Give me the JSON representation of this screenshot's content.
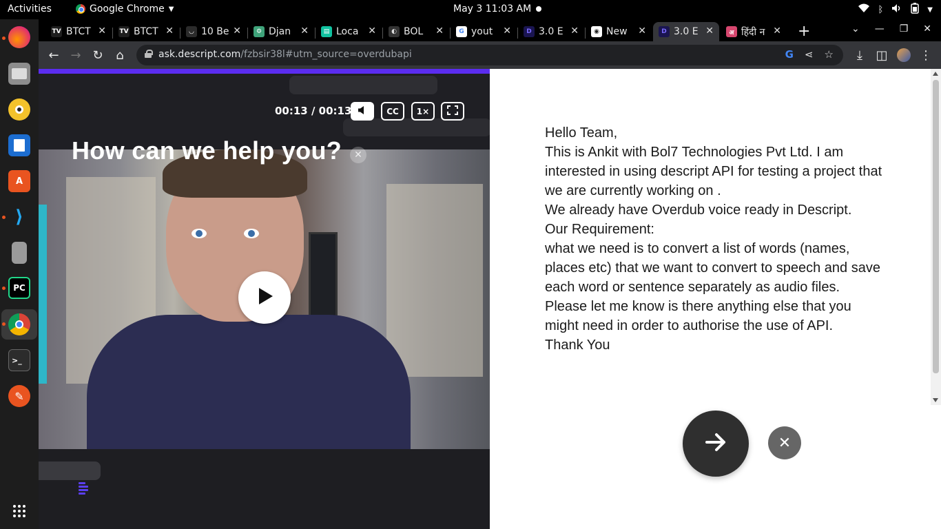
{
  "topbar": {
    "activities": "Activities",
    "app_name": "Google Chrome",
    "clock": "May 3  11:03 AM"
  },
  "dock": {
    "apps": [
      "firefox-icon",
      "files-icon",
      "rhythmbox-icon",
      "writer-icon",
      "software-icon",
      "vscode-icon",
      "archive-icon",
      "pycharm-icon",
      "chrome-icon",
      "terminal-icon",
      "pen-icon",
      "app-grid-icon"
    ]
  },
  "tabs": [
    {
      "title": "BTCT",
      "favicon": "TV"
    },
    {
      "title": "BTCT",
      "favicon": "TV"
    },
    {
      "title": "10 Be",
      "favicon": "◡"
    },
    {
      "title": "Djan",
      "favicon": "⚙"
    },
    {
      "title": "Loca",
      "favicon": "▤"
    },
    {
      "title": "BOL",
      "favicon": "◐"
    },
    {
      "title": "yout",
      "favicon": "G"
    },
    {
      "title": "3.0 E",
      "favicon": "D"
    },
    {
      "title": "New",
      "favicon": "◉"
    },
    {
      "title": "3.0 E",
      "favicon": "D",
      "active": true
    },
    {
      "title": "हिंदी न",
      "favicon": "अ"
    }
  ],
  "address_bar": {
    "host": "ask.descript.com",
    "path": "/fzbsir38l#utm_source=overdubapi"
  },
  "video": {
    "question": "How can we help you?",
    "time": "00:13 / 00:13",
    "cc_label": "CC",
    "speed_label": "1×"
  },
  "message": {
    "lines": [
      "Hello Team,",
      "This is Ankit with Bol7 Technologies Pvt Ltd. I am interested in using descript API for testing a project that we are currently working on .",
      "We already have Overdub voice ready in Descript.",
      "Our Requirement:",
      "what we need is to convert a list of words (names, places etc) that we want to convert to speech and save each word or sentence separately as audio files.",
      "Please let me know is there anything else that you might need in order to authorise the use of API.",
      "Thank You"
    ]
  },
  "colors": {
    "accent": "#5b2cf0",
    "submit": "#2f2f2f",
    "cancel": "#666666"
  }
}
